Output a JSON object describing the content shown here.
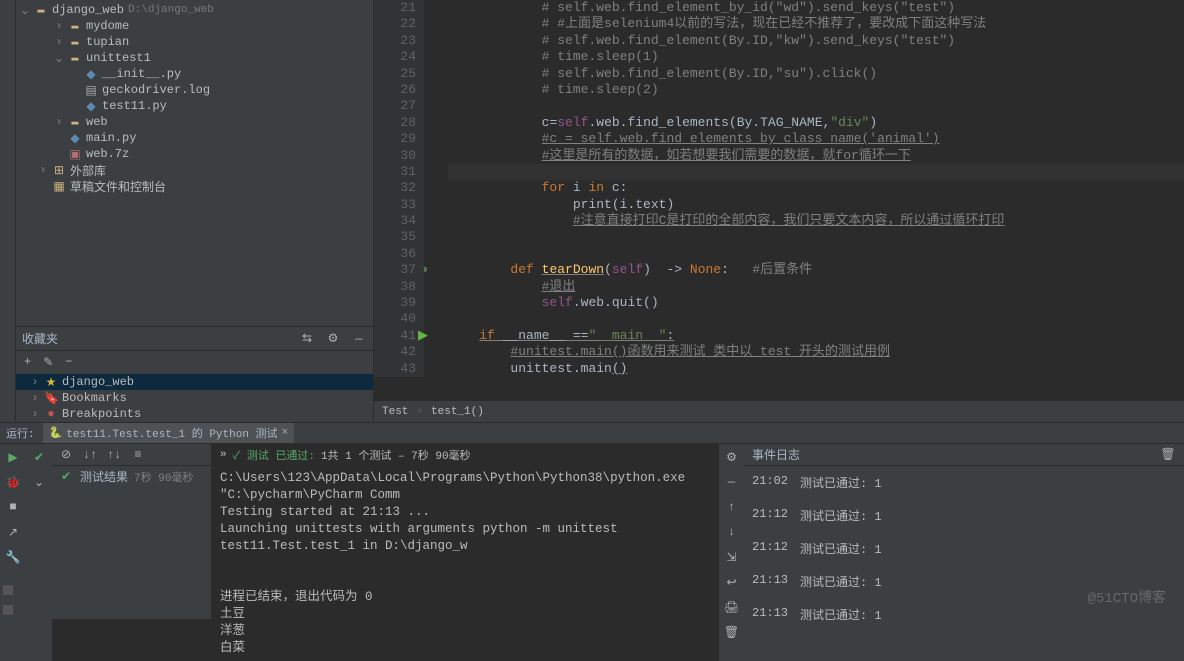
{
  "project": {
    "root": {
      "name": "django_web",
      "path": "D:\\django_web"
    },
    "tree": [
      {
        "kind": "folder",
        "label": "mydome",
        "indent": 1,
        "chev": "›"
      },
      {
        "kind": "folder",
        "label": "tupian",
        "indent": 1,
        "chev": "›"
      },
      {
        "kind": "folder",
        "label": "unittest1",
        "indent": 1,
        "chev": "⌄"
      },
      {
        "kind": "py",
        "label": "__init__.py",
        "indent": 2
      },
      {
        "kind": "log",
        "label": "geckodriver.log",
        "indent": 2
      },
      {
        "kind": "py",
        "label": "test11.py",
        "indent": 2
      },
      {
        "kind": "folder",
        "label": "web",
        "indent": 1,
        "chev": "›"
      },
      {
        "kind": "py",
        "label": "main.py",
        "indent": 1
      },
      {
        "kind": "archive",
        "label": "web.7z",
        "indent": 1
      },
      {
        "kind": "lib",
        "label": "外部库",
        "indent": 0,
        "chev": "›"
      },
      {
        "kind": "scratch",
        "label": "草稿文件和控制台",
        "indent": 0
      }
    ]
  },
  "favorites": {
    "title": "收藏夹",
    "items": [
      {
        "icon": "star",
        "label": "django_web",
        "selected": true
      },
      {
        "icon": "bookmark",
        "label": "Bookmarks"
      },
      {
        "icon": "breakpoint",
        "label": "Breakpoints"
      }
    ]
  },
  "code": {
    "lines": [
      {
        "n": 21,
        "html": "            <span class='cmt'># self.web.find_element_by_id(\"wd\").send_keys(\"test\")</span>"
      },
      {
        "n": 22,
        "html": "            <span class='cmt'># #上面是selenium4以前的写法，现在已经不推荐了，要改成下面这种写法</span>"
      },
      {
        "n": 23,
        "html": "            <span class='cmt'># self.web.find_element(By.ID,\"kw\").send_keys(\"test\")</span>"
      },
      {
        "n": 24,
        "html": "            <span class='cmt'># time.sleep(1)</span>"
      },
      {
        "n": 25,
        "html": "            <span class='cmt'># self.web.find_element(By.ID,\"su\").click()</span>"
      },
      {
        "n": 26,
        "html": "            <span class='cmt'># time.sleep(2)</span>"
      },
      {
        "n": 27,
        "html": ""
      },
      {
        "n": 28,
        "html": "            <span class='id'>c</span>=<span class='slf'>self</span>.web.find_elements(By.TAG_NAME,<span class='str'>\"div\"</span>)"
      },
      {
        "n": 29,
        "html": "            <span class='cmt underl'>#c = self.web.find_elements_by_class_name('animal')</span>"
      },
      {
        "n": 30,
        "html": "            <span class='cmt underl'>#这里是所有的数据，如若想要我们需要的数据，就for循环一下</span>"
      },
      {
        "n": 31,
        "html": "",
        "current": true
      },
      {
        "n": 32,
        "html": "            <span class='kw'>for</span> i <span class='kw'>in</span> c:"
      },
      {
        "n": 33,
        "html": "                <span class='id'>print</span>(i.text)"
      },
      {
        "n": 34,
        "html": "                <span class='cmt underl'>#注意直接打印C是打印的全部内容，我们只要文本内容，所以通过循环打印</span>"
      },
      {
        "n": 35,
        "html": ""
      },
      {
        "n": 36,
        "html": ""
      },
      {
        "n": 37,
        "html": "        <span class='kw'>def </span><span class='fn underl'>tearDown</span>(<span class='slf'>self</span>)  -> <span class='kw'>None</span>:   <span class='cmt'>#后置条件</span>",
        "mark": "c"
      },
      {
        "n": 38,
        "html": "            <span class='cmt underl'>#退出</span>"
      },
      {
        "n": 39,
        "html": "            <span class='slf'>self</span>.web.quit()"
      },
      {
        "n": 40,
        "html": ""
      },
      {
        "n": 41,
        "html": "    <span class='kw underl'>if</span><span class='underl'> __name__ ==</span><span class='str underl'>\"__main__\"</span><span class='underl'>:</span>",
        "mark": "r"
      },
      {
        "n": 42,
        "html": "        <span class='cmt underl'>#unitest.main()函数用来测试 类中以 test 开头的测试用例</span>"
      },
      {
        "n": 43,
        "html": "        unittest.main<span class='underl'>()</span>"
      }
    ],
    "breadcrumbs": [
      "Test",
      "test_1()"
    ]
  },
  "run": {
    "title": "运行:",
    "tab": "test11.Test.test_1 的 Python 测试",
    "status_prefix": "✓ 测试 已通过:",
    "status_text": "1共 1 个测试 – 7秒 90毫秒",
    "chevs": "»",
    "tree_root": "测试结果",
    "tree_time": "7秒 90毫秒",
    "console_lines": [
      "C:\\Users\\123\\AppData\\Local\\Programs\\Python\\Python38\\python.exe \"C:\\pycharm\\PyCharm Comm",
      "Testing started at 21:13 ...",
      "Launching unittests with arguments python -m unittest test11.Test.test_1 in D:\\django_w",
      "",
      "",
      "进程已结束，退出代码为 0",
      "土豆",
      "洋葱",
      "白菜"
    ]
  },
  "events": {
    "title": "事件日志",
    "rows": [
      {
        "t": "21:02",
        "msg": "测试已通过: 1"
      },
      {
        "t": "21:12",
        "msg": "测试已通过: 1"
      },
      {
        "t": "21:12",
        "msg": "测试已通过: 1"
      },
      {
        "t": "21:13",
        "msg": "测试已通过: 1"
      },
      {
        "t": "21:13",
        "msg": "测试已通过: 1"
      }
    ]
  },
  "watermark": "@51CTO博客"
}
